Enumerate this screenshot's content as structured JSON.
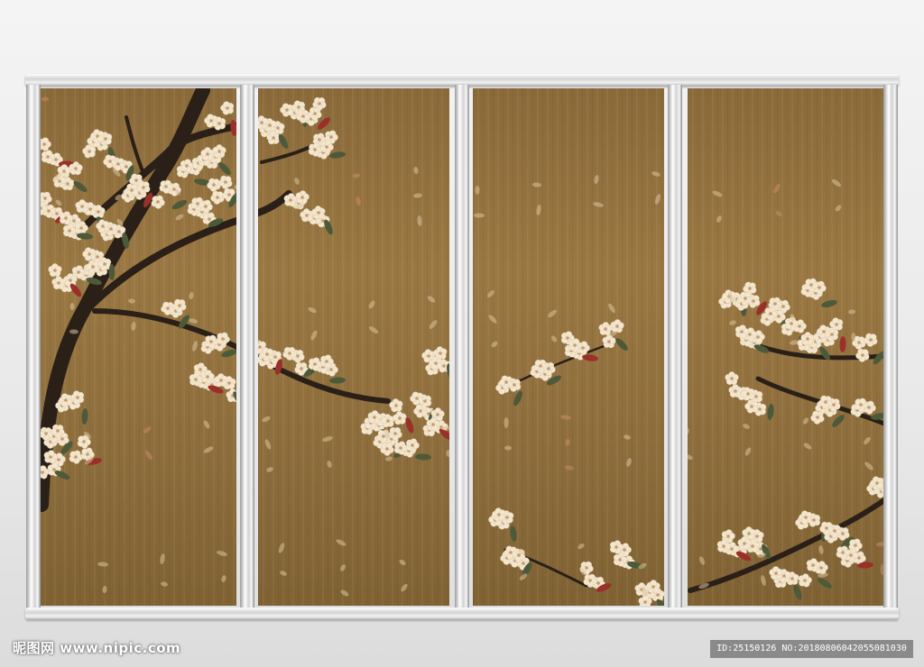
{
  "image": {
    "description_subject": "four-panel wood screen with plum blossom painting",
    "colors": {
      "wood": "#8f6f3d",
      "branch": "#2a2018",
      "blossom": "#f3e6cf",
      "blossom_center": "#c79a6a",
      "leaf": "#4d5a3a",
      "red_leaf": "#9b2f2a",
      "frame": "#d9d9d9"
    }
  },
  "watermark": {
    "site": "昵图网 www.nipic.com",
    "id_text": "ID:25150126 NO:20180806042055081030"
  }
}
